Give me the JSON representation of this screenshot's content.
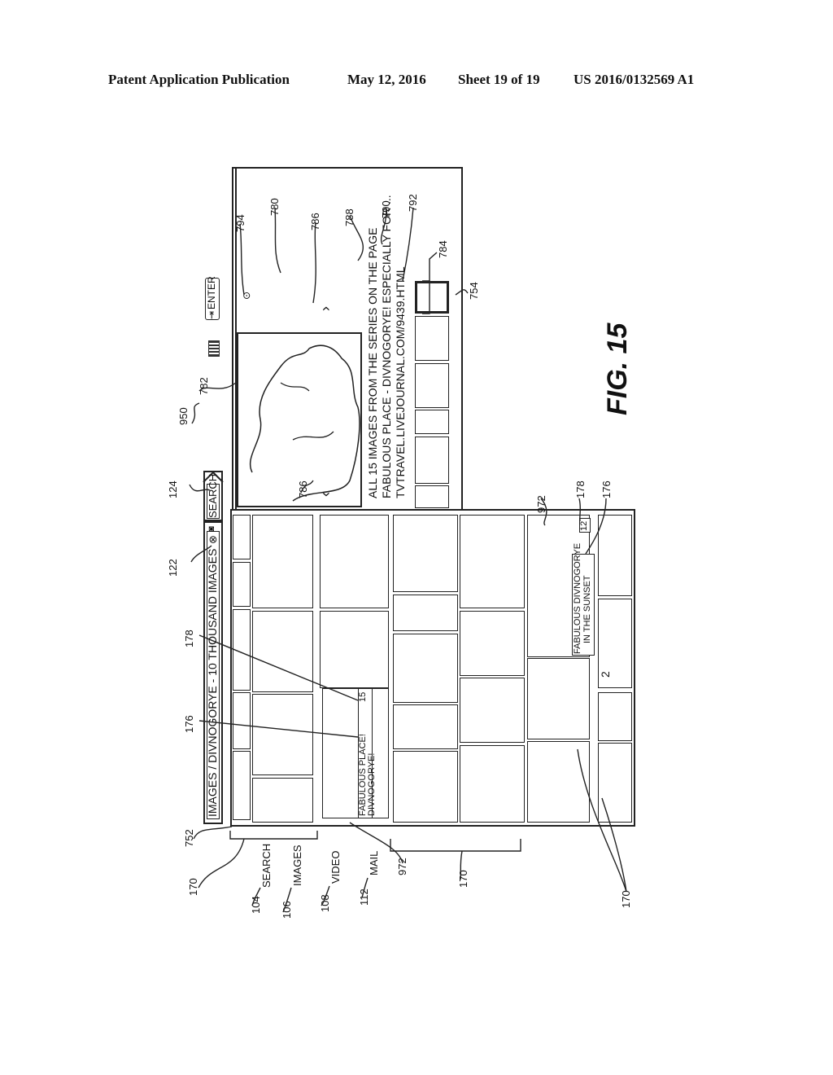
{
  "header": {
    "publication_type": "Patent Application Publication",
    "date": "May 12, 2016",
    "sheet": "Sheet 19 of 19",
    "pub_number": "US 2016/0132569 A1"
  },
  "figure_label": "FIG. 15",
  "ui": {
    "breadcrumb": "IMAGES / DIVNOGORYE - 10 THOUSAND IMAGES",
    "clear_icon": "⊗",
    "camera_icon": "◙",
    "search_button": "SEARCH",
    "enter_button": "ENTER",
    "keyboard_icon": "keyboard-icon",
    "preview": {
      "caption_line1": "ALL 15 IMAGES FROM THE SERIES ON THE PAGE",
      "caption_line2": "FABULOUS PLACE - DIVNOGORYE! ESPECIALLY FOR ...",
      "caption_line3": "TVTRAVEL.LIVEJOURNAL.COM/9439.HTML"
    },
    "tile_a": {
      "title": "FABULOUS PLACE!",
      "subtitle": "DIVNOGORYE!",
      "count": "15"
    },
    "tile_b": {
      "title": "FABULOUS DIVNOGORYE",
      "subtitle": "IN THE SUNSET",
      "count": "12"
    },
    "page_number": "2"
  },
  "nav_labels": [
    {
      "ref": "104",
      "label": "SEARCH"
    },
    {
      "ref": "106",
      "label": "IMAGES"
    },
    {
      "ref": "108",
      "label": "VIDEO"
    },
    {
      "ref": "112",
      "label": "MAIL"
    }
  ],
  "reference_numerals": {
    "r950": "950",
    "r122": "122",
    "r124": "124",
    "r178a": "178",
    "r176a": "176",
    "r752": "752",
    "r170a": "170",
    "r972a": "972",
    "r170b": "170",
    "r170c": "170",
    "r972b": "972",
    "r178b": "178",
    "r176b": "176",
    "r786a": "786",
    "r782": "782",
    "r794": "794",
    "r780": "780",
    "r786b": "786",
    "r788": "788",
    "r790": "790",
    "r792": "792",
    "r784": "784",
    "r754": "754"
  }
}
